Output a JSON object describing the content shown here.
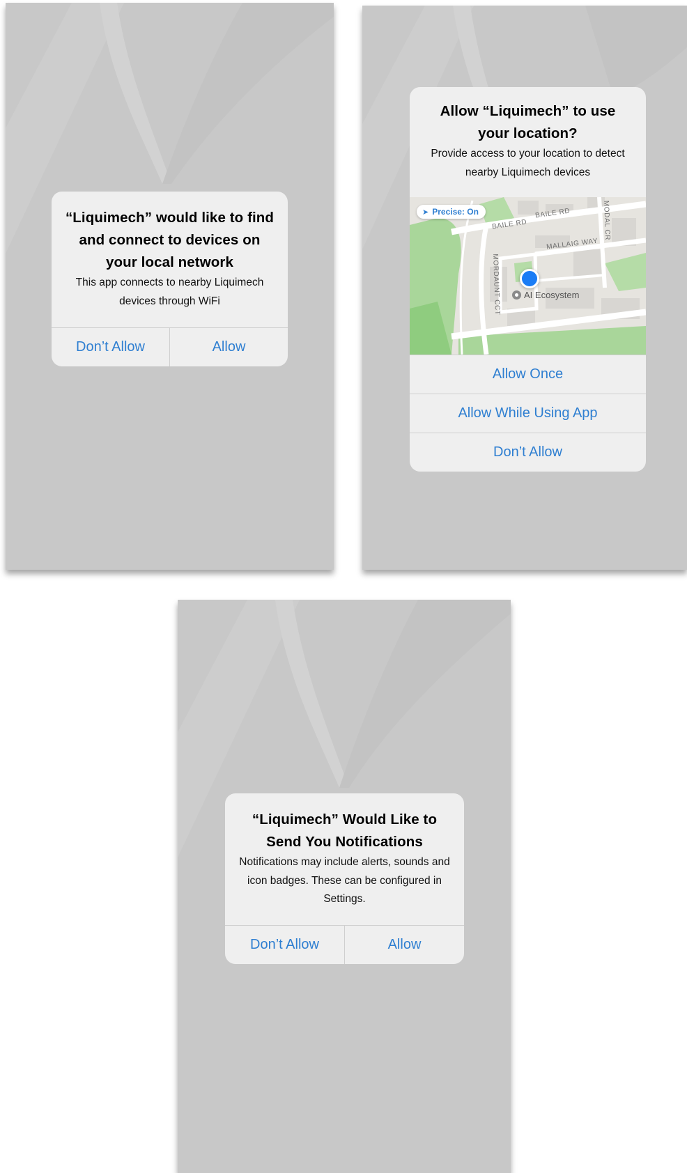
{
  "local_network_alert": {
    "title": "“Liquimech” would like to find and connect to devices on your local network",
    "message": "This app connects to nearby Liquimech devices through WiFi",
    "deny_label": "Don’t Allow",
    "allow_label": "Allow"
  },
  "location_alert": {
    "title": "Allow “Liquimech” to use your location?",
    "message": "Provide access to your location to detect nearby Liquimech devices",
    "map": {
      "precise_label": "Precise: On",
      "roads": [
        "BAILE RD",
        "BAILE RD",
        "MALLAIG WAY",
        "MODAL CR",
        "MORDAUNT CCT"
      ],
      "poi_label": "AI Ecosystem"
    },
    "buttons": [
      "Allow Once",
      "Allow While Using App",
      "Don’t Allow"
    ]
  },
  "notifications_alert": {
    "title": "“Liquimech” Would Like to Send You Notifications",
    "message": "Notifications may include alerts, sounds and icon badges. These can be configured in Settings.",
    "deny_label": "Don’t Allow",
    "allow_label": "Allow"
  },
  "colors": {
    "screen_background": "#c8c8c8",
    "alert_background": "#efefef",
    "button_text": "#2f7fd1",
    "location_dot": "#1a7cf5"
  }
}
